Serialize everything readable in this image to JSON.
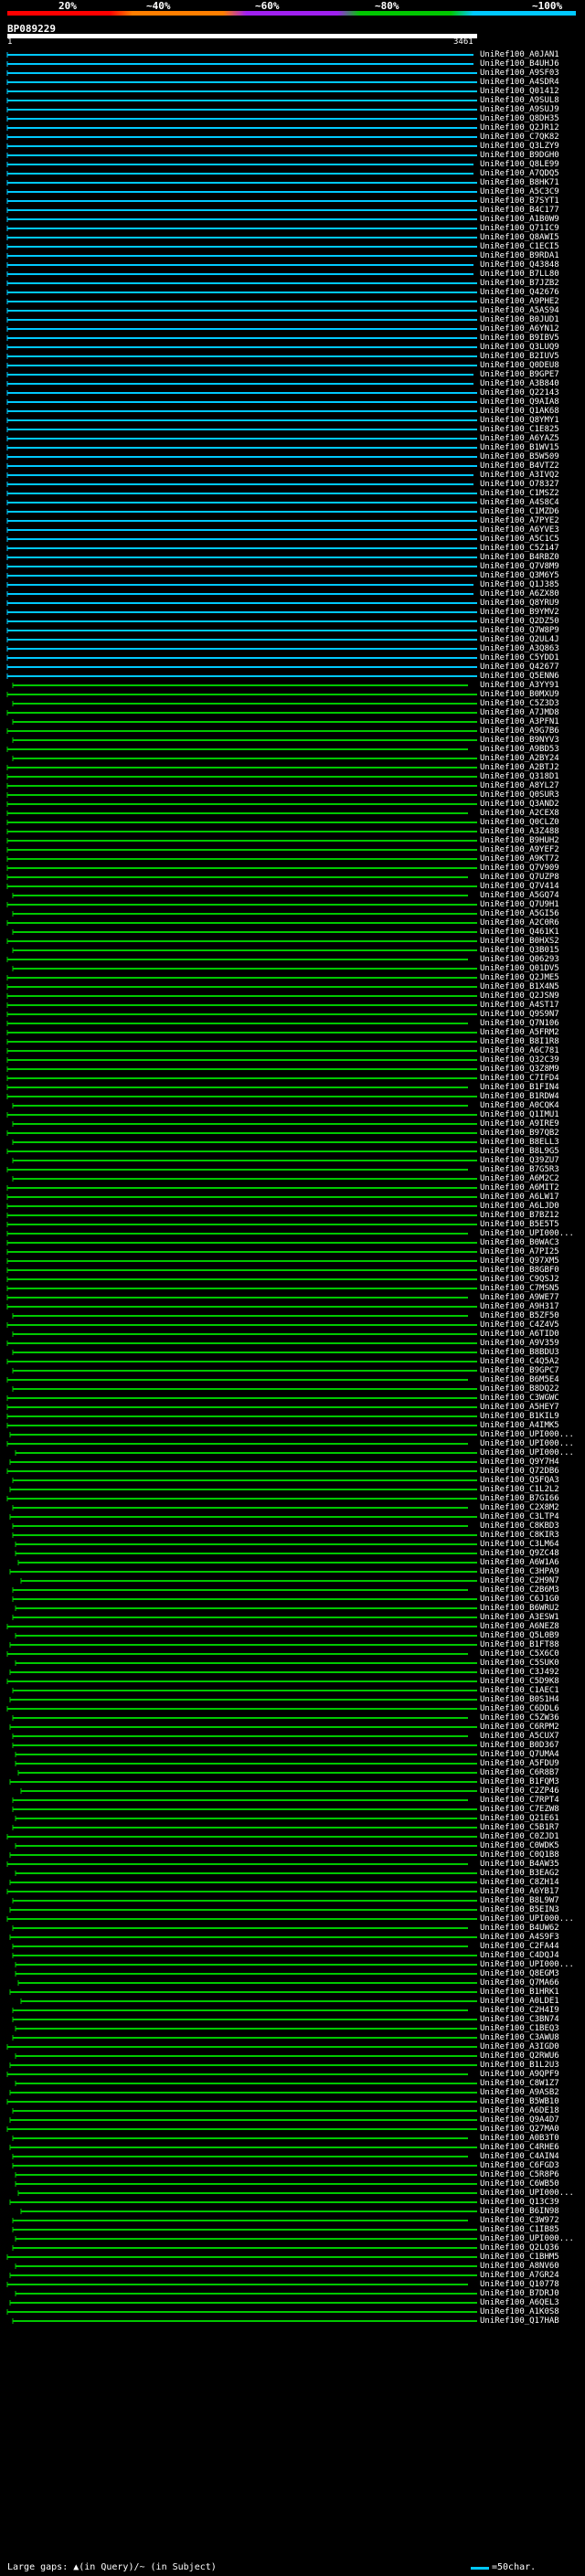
{
  "legend": {
    "labels": [
      "20%",
      "~40%",
      "~60%",
      "~80%",
      "~100%"
    ]
  },
  "query": {
    "id": "BP089229",
    "start": "1",
    "end": "3461",
    "length": 3461
  },
  "hits": [
    "UniRef100_A0JAN1",
    "UniRef100_B4UHJ6",
    "UniRef100_A9SF03",
    "UniRef100_A4SDR4",
    "UniRef100_Q01412",
    "UniRef100_A9SUL8",
    "UniRef100_A9SUJ9",
    "UniRef100_Q8DH35",
    "UniRef100_Q2JR12",
    "UniRef100_C7QK82",
    "UniRef100_Q3LZY9",
    "UniRef100_B9DGH0",
    "UniRef100_Q8LE99",
    "UniRef100_A7QDQ5",
    "UniRef100_B8HK71",
    "UniRef100_A5C3C9",
    "UniRef100_B7SYT1",
    "UniRef100_B4C177",
    "UniRef100_A1B0W9",
    "UniRef100_Q71IC9",
    "UniRef100_Q8AWI5",
    "UniRef100_C1ECI5",
    "UniRef100_B9RDA1",
    "UniRef100_Q43848",
    "UniRef100_B7LL80",
    "UniRef100_B7JZB2",
    "UniRef100_Q42676",
    "UniRef100_A9PHE2",
    "UniRef100_A5AS94",
    "UniRef100_B0JUD1",
    "UniRef100_A6YN12",
    "UniRef100_B9IBV5",
    "UniRef100_Q3LUQ9",
    "UniRef100_B2IUV5",
    "UniRef100_Q0DEU8",
    "UniRef100_B9GPE7",
    "UniRef100_A3B840",
    "UniRef100_Q22143",
    "UniRef100_Q9AIA8",
    "UniRef100_Q1AK68",
    "UniRef100_Q8YMY1",
    "UniRef100_C1E825",
    "UniRef100_A6YAZ5",
    "UniRef100_B1WV15",
    "UniRef100_B5W509",
    "UniRef100_B4VTZ2",
    "UniRef100_A3IVQ2",
    "UniRef100_O78327",
    "UniRef100_C1MSZ2",
    "UniRef100_A4S8C4",
    "UniRef100_C1MZD6",
    "UniRef100_A7PYE2",
    "UniRef100_A6YVE3",
    "UniRef100_A5C1C5",
    "UniRef100_C5Z147",
    "UniRef100_B4RBZ0",
    "UniRef100_Q7V8M9",
    "UniRef100_Q3M6Y5",
    "UniRef100_Q1J385",
    "UniRef100_A6ZX80",
    "UniRef100_Q8YRU9",
    "UniRef100_B9YMV2",
    "UniRef100_Q2DZ50",
    "UniRef100_Q7W8P9",
    "UniRef100_Q2UL4J",
    "UniRef100_A3Q863",
    "UniRef100_C5YDD1",
    "UniRef100_Q42677",
    "UniRef100_Q5ENN6",
    "UniRef100_A3YY91",
    "UniRef100_B0MXU9",
    "UniRef100_C5Z3D3",
    "UniRef100_A7JMD8",
    "UniRef100_A3PFN1",
    "UniRef100_A9G7B6",
    "UniRef100_B9NYV3",
    "UniRef100_A9BD53",
    "UniRef100_A2BY24",
    "UniRef100_A2BTJ2",
    "UniRef100_Q318D1",
    "UniRef100_A8YL27",
    "UniRef100_Q0SUR3",
    "UniRef100_Q3AND2",
    "UniRef100_A2CEX8",
    "UniRef100_Q0CLZ0",
    "UniRef100_A3Z488",
    "UniRef100_B9HUH2",
    "UniRef100_A9YEF2",
    "UniRef100_A9KT72",
    "UniRef100_Q7V909",
    "UniRef100_Q7UZP8",
    "UniRef100_Q7V414",
    "UniRef100_A5GQ74",
    "UniRef100_Q7U9H1",
    "UniRef100_A5GI56",
    "UniRef100_A2C0R6",
    "UniRef100_Q461K1",
    "UniRef100_B0HXS2",
    "UniRef100_Q3B015",
    "UniRef100_Q06293",
    "UniRef100_Q01DV5",
    "UniRef100_Q2JME5",
    "UniRef100_B1X4N5",
    "UniRef100_Q2JSN9",
    "UniRef100_A4ST17",
    "UniRef100_Q9S9N7",
    "UniRef100_Q7N106",
    "UniRef100_A5FRM2",
    "UniRef100_B8I1R8",
    "UniRef100_A6C781",
    "UniRef100_Q32C39",
    "UniRef100_Q3Z8M9",
    "UniRef100_C7IFD4",
    "UniRef100_B1FIN4",
    "UniRef100_B1RDW4",
    "UniRef100_A0CQK4",
    "UniRef100_Q1IMU1",
    "UniRef100_A9IRE9",
    "UniRef100_B97QB2",
    "UniRef100_B8ELL3",
    "UniRef100_B8L9G5",
    "UniRef100_Q39ZU7",
    "UniRef100_B7G5R3",
    "UniRef100_A6M2C2",
    "UniRef100_A6MIT2",
    "UniRef100_A6LW17",
    "UniRef100_A6LJD0",
    "UniRef100_B7BZ12",
    "UniRef100_B5E5T5",
    "UniRef100_UPI000...",
    "UniRef100_B0WAC3",
    "UniRef100_A7PI25",
    "UniRef100_Q97XM5",
    "UniRef100_B8GBF0",
    "UniRef100_C9QSJ2",
    "UniRef100_C7MSN5",
    "UniRef100_A9WE77",
    "UniRef100_A9H317",
    "UniRef100_B5ZF50",
    "UniRef100_C4Z4V5",
    "UniRef100_A6TID0",
    "UniRef100_A9V359",
    "UniRef100_B8BDU3",
    "UniRef100_C4Q5A2",
    "UniRef100_B9GPC7",
    "UniRef100_B6M5E4",
    "UniRef100_B8DQ22",
    "UniRef100_C3WGWC",
    "UniRef100_A5HEY7",
    "UniRef100_B1KIL9",
    "UniRef100_A4IMK5",
    "UniRef100_UPI000...",
    "UniRef100_UPI000...",
    "UniRef100_UPI000...",
    "UniRef100_Q9Y7H4",
    "UniRef100_Q72DB6",
    "UniRef100_Q5FQA3",
    "UniRef100_C1L2L2",
    "UniRef100_B7GI66",
    "UniRef100_C2X8M2",
    "UniRef100_C3LTP4",
    "UniRef100_C8KBD3",
    "UniRef100_C8KIR3",
    "UniRef100_C3LM64",
    "UniRef100_Q9ZC48",
    "UniRef100_A6W1A6",
    "UniRef100_C3HPA9",
    "UniRef100_C2H9N7",
    "UniRef100_C2B6M3",
    "UniRef100_C6J1G0",
    "UniRef100_B6WRU2",
    "UniRef100_A3ESW1",
    "UniRef100_A6NEZ8",
    "UniRef100_Q5L0B9",
    "UniRef100_B1FT88",
    "UniRef100_C5X6C0",
    "UniRef100_C5SUK0",
    "UniRef100_C3J492",
    "UniRef100_C5D9K8",
    "UniRef100_C1AEC1",
    "UniRef100_B0S1H4",
    "UniRef100_C6DDL6",
    "UniRef100_C5ZW36",
    "UniRef100_C6RPM2",
    "UniRef100_A5CUX7",
    "UniRef100_B0D367",
    "UniRef100_Q7UMA4",
    "UniRef100_A5FDU9",
    "UniRef100_C6R8B7",
    "UniRef100_B1FQM3",
    "UniRef100_C2ZP46",
    "UniRef100_C7RPT4",
    "UniRef100_C7EZW8",
    "UniRef100_Q21E61",
    "UniRef100_C5B1R7",
    "UniRef100_C0ZJD1",
    "UniRef100_C0WDK5",
    "UniRef100_C0Q1B8",
    "UniRef100_B4AW35",
    "UniRef100_B3EAG2",
    "UniRef100_C8ZH14",
    "UniRef100_A6YB17",
    "UniRef100_B8L9W7",
    "UniRef100_B5EIN3",
    "UniRef100_UPI000...",
    "UniRef100_B4UW62",
    "UniRef100_A4S9F3",
    "UniRef100_C2FA44",
    "UniRef100_C4DQJ4",
    "UniRef100_UPI000...",
    "UniRef100_Q8EGM3",
    "UniRef100_Q7MA66",
    "UniRef100_B1HRK1",
    "UniRef100_A0LDE1",
    "UniRef100_C2H4I9",
    "UniRef100_C3BN74",
    "UniRef100_C1BEQ3",
    "UniRef100_C3AWU8",
    "UniRef100_A3IGD0",
    "UniRef100_Q2RWU6",
    "UniRef100_B1L2U3",
    "UniRef100_A9QPF9",
    "UniRef100_C8W1Z7",
    "UniRef100_A9ASB2",
    "UniRef100_B5WB10",
    "UniRef100_A6DE18",
    "UniRef100_Q9A4D7",
    "UniRef100_Q27MA0",
    "UniRef100_A0B3T0",
    "UniRef100_C4RHE6",
    "UniRef100_C4AIN4",
    "UniRef100_C6FGD3",
    "UniRef100_C5R8P6",
    "UniRef100_C6WB50",
    "UniRef100_UPI000...",
    "UniRef100_Q13C39",
    "UniRef100_B6IN98",
    "UniRef100_C3W972",
    "UniRef100_C1IB85",
    "UniRef100_UPI000...",
    "UniRef100_Q2LQ36",
    "UniRef100_C1BHM5",
    "UniRef100_A8NV60",
    "UniRef100_A7GR24",
    "UniRef100_Q10778",
    "UniRef100_B7DRJ0",
    "UniRef100_A6QEL3",
    "UniRef100_A1K0S8",
    "UniRef100_Q17HAB"
  ],
  "colors": {
    "cyan": "#00c8ff",
    "green": "#00c800",
    "red": "#ff0000",
    "orange": "#ff7f00",
    "purple": "#a020f0"
  },
  "footer": {
    "gap_note": "Large gaps: ▲(in Query)/~ (in Subject)",
    "scale_label": "=50char."
  }
}
